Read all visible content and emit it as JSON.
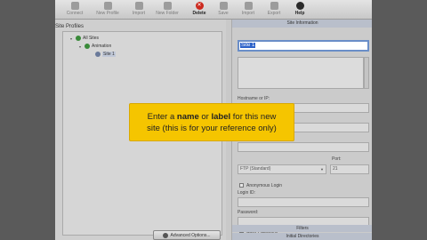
{
  "toolbar": {
    "buttons": [
      {
        "label": "Connect",
        "icon": "home-icon"
      },
      {
        "label": "New Profile",
        "icon": "new-profile-icon"
      },
      {
        "label": "Import",
        "icon": "import-icon"
      },
      {
        "label": "New Folder",
        "icon": "new-folder-icon"
      },
      {
        "label": "Delete",
        "icon": "delete-icon"
      },
      {
        "label": "Save",
        "icon": "save-icon"
      },
      {
        "label": "Import",
        "icon": "import-icon"
      },
      {
        "label": "Export",
        "icon": "export-icon"
      },
      {
        "label": "Help",
        "icon": "help-icon"
      }
    ],
    "delete_glyph": "✕"
  },
  "left": {
    "title": "Site Profiles",
    "tree": {
      "root": "All Sites",
      "folder": "Animation",
      "site": "Site 1"
    },
    "advanced_button": "Advanced Options..."
  },
  "right": {
    "header": "Site Information",
    "site_name": "Site 1",
    "host_label": "Hostname or IP:",
    "protocol_value": "FTP (Standard)",
    "port_label": "Port:",
    "port_value": "21",
    "anon_label": "Anonymous Login",
    "login_label": "Login ID:",
    "password_label": "Password:",
    "save_password_label": "Save Password",
    "footer1": "Filters",
    "footer2": "Initial Directories"
  },
  "callout": {
    "pre": "Enter a ",
    "name": "name",
    "mid": " or ",
    "label": "label",
    "post": " for this new",
    "line2": "site (this is for your reference only)"
  }
}
